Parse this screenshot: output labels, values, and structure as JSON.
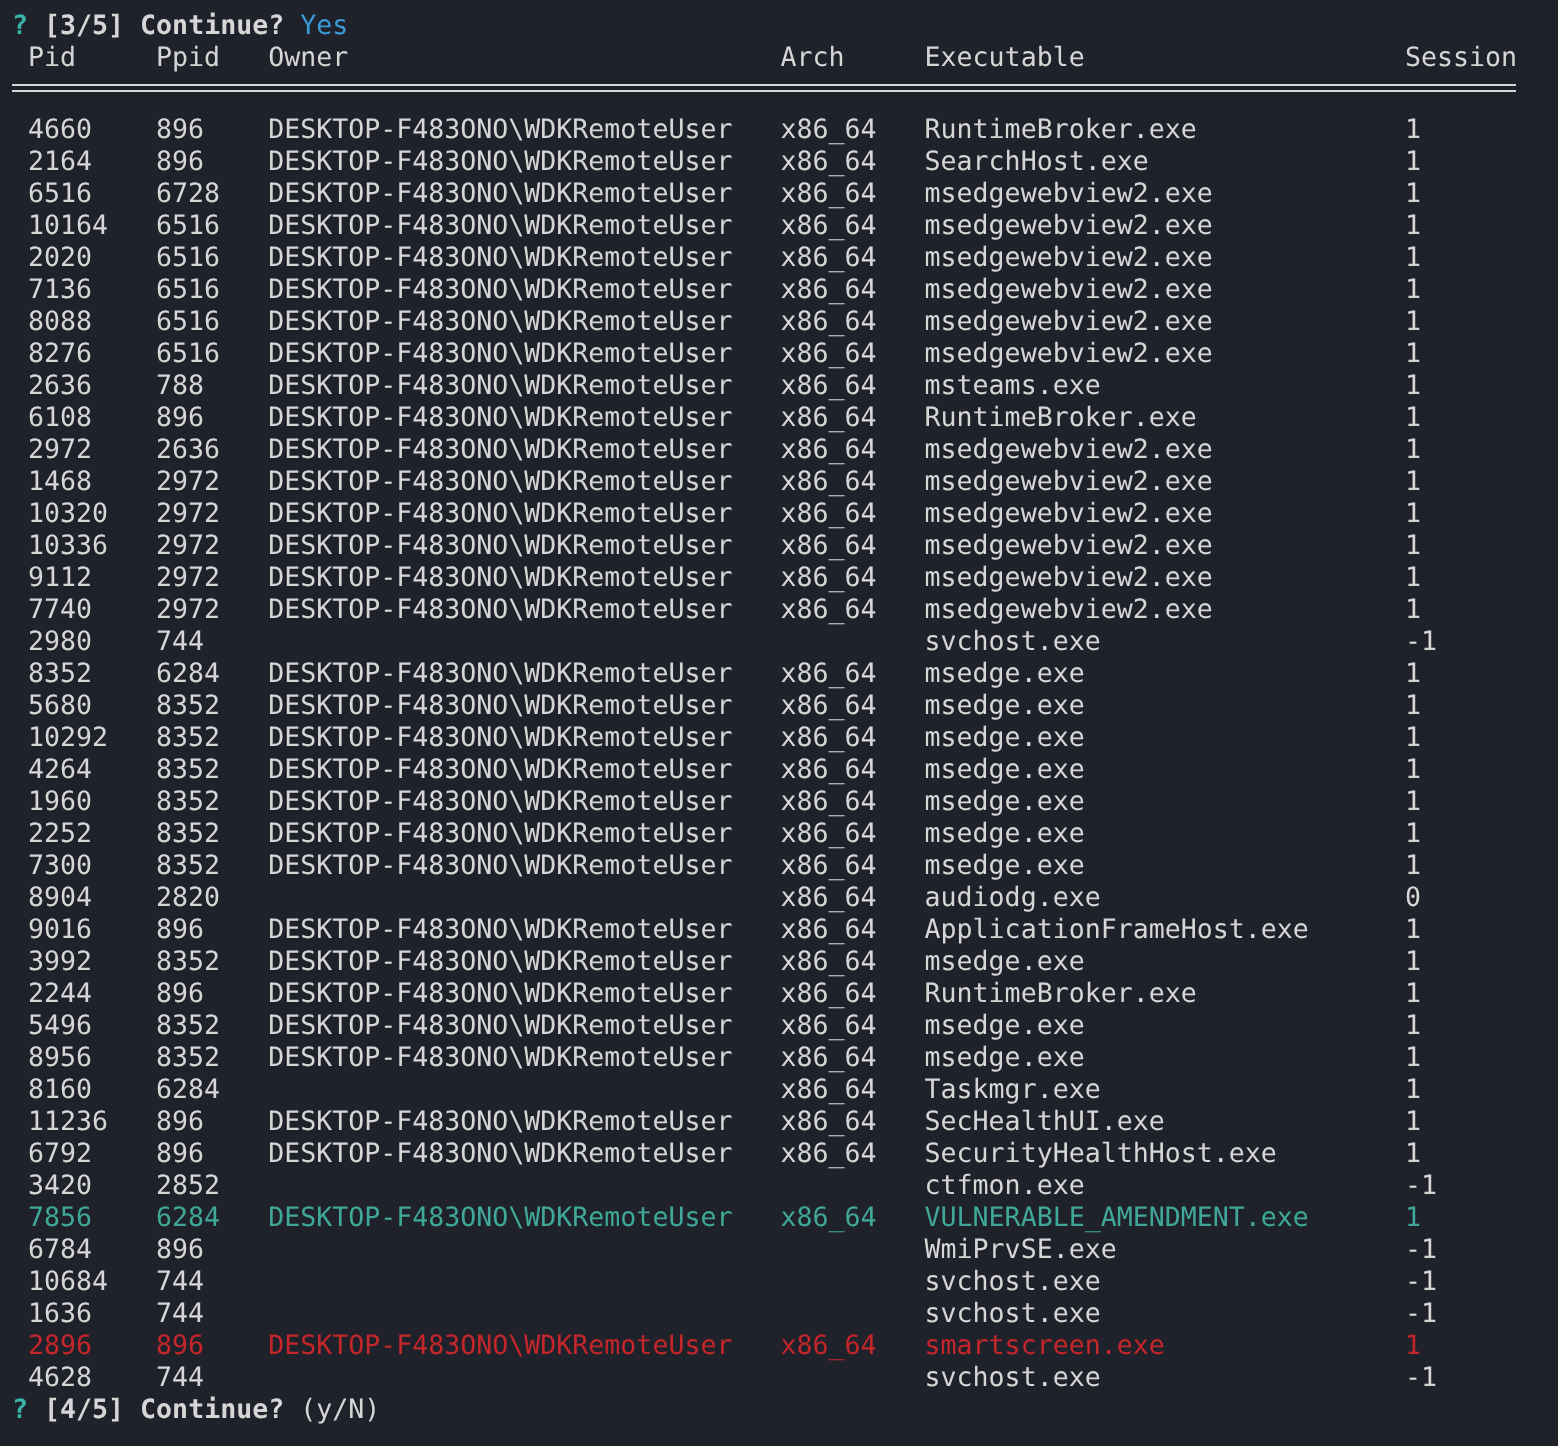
{
  "prompt_top": {
    "mark": "?",
    "step": "[3/5]",
    "question": "Continue?",
    "answer": "Yes"
  },
  "columns": [
    "Pid",
    "Ppid",
    "Owner",
    "Arch",
    "Executable",
    "Session"
  ],
  "rows": [
    {
      "kind": "normal",
      "cells": [
        "4660",
        "896",
        "DESKTOP-F483ONO\\WDKRemoteUser",
        "x86_64",
        "RuntimeBroker.exe",
        "1"
      ]
    },
    {
      "kind": "normal",
      "cells": [
        "2164",
        "896",
        "DESKTOP-F483ONO\\WDKRemoteUser",
        "x86_64",
        "SearchHost.exe",
        "1"
      ]
    },
    {
      "kind": "normal",
      "cells": [
        "6516",
        "6728",
        "DESKTOP-F483ONO\\WDKRemoteUser",
        "x86_64",
        "msedgewebview2.exe",
        "1"
      ]
    },
    {
      "kind": "normal",
      "cells": [
        "10164",
        "6516",
        "DESKTOP-F483ONO\\WDKRemoteUser",
        "x86_64",
        "msedgewebview2.exe",
        "1"
      ]
    },
    {
      "kind": "normal",
      "cells": [
        "2020",
        "6516",
        "DESKTOP-F483ONO\\WDKRemoteUser",
        "x86_64",
        "msedgewebview2.exe",
        "1"
      ]
    },
    {
      "kind": "normal",
      "cells": [
        "7136",
        "6516",
        "DESKTOP-F483ONO\\WDKRemoteUser",
        "x86_64",
        "msedgewebview2.exe",
        "1"
      ]
    },
    {
      "kind": "normal",
      "cells": [
        "8088",
        "6516",
        "DESKTOP-F483ONO\\WDKRemoteUser",
        "x86_64",
        "msedgewebview2.exe",
        "1"
      ]
    },
    {
      "kind": "normal",
      "cells": [
        "8276",
        "6516",
        "DESKTOP-F483ONO\\WDKRemoteUser",
        "x86_64",
        "msedgewebview2.exe",
        "1"
      ]
    },
    {
      "kind": "normal",
      "cells": [
        "2636",
        "788",
        "DESKTOP-F483ONO\\WDKRemoteUser",
        "x86_64",
        "msteams.exe",
        "1"
      ]
    },
    {
      "kind": "normal",
      "cells": [
        "6108",
        "896",
        "DESKTOP-F483ONO\\WDKRemoteUser",
        "x86_64",
        "RuntimeBroker.exe",
        "1"
      ]
    },
    {
      "kind": "normal",
      "cells": [
        "2972",
        "2636",
        "DESKTOP-F483ONO\\WDKRemoteUser",
        "x86_64",
        "msedgewebview2.exe",
        "1"
      ]
    },
    {
      "kind": "normal",
      "cells": [
        "1468",
        "2972",
        "DESKTOP-F483ONO\\WDKRemoteUser",
        "x86_64",
        "msedgewebview2.exe",
        "1"
      ]
    },
    {
      "kind": "normal",
      "cells": [
        "10320",
        "2972",
        "DESKTOP-F483ONO\\WDKRemoteUser",
        "x86_64",
        "msedgewebview2.exe",
        "1"
      ]
    },
    {
      "kind": "normal",
      "cells": [
        "10336",
        "2972",
        "DESKTOP-F483ONO\\WDKRemoteUser",
        "x86_64",
        "msedgewebview2.exe",
        "1"
      ]
    },
    {
      "kind": "normal",
      "cells": [
        "9112",
        "2972",
        "DESKTOP-F483ONO\\WDKRemoteUser",
        "x86_64",
        "msedgewebview2.exe",
        "1"
      ]
    },
    {
      "kind": "normal",
      "cells": [
        "7740",
        "2972",
        "DESKTOP-F483ONO\\WDKRemoteUser",
        "x86_64",
        "msedgewebview2.exe",
        "1"
      ]
    },
    {
      "kind": "normal",
      "cells": [
        "2980",
        "744",
        "",
        "",
        "svchost.exe",
        "-1"
      ]
    },
    {
      "kind": "normal",
      "cells": [
        "8352",
        "6284",
        "DESKTOP-F483ONO\\WDKRemoteUser",
        "x86_64",
        "msedge.exe",
        "1"
      ]
    },
    {
      "kind": "normal",
      "cells": [
        "5680",
        "8352",
        "DESKTOP-F483ONO\\WDKRemoteUser",
        "x86_64",
        "msedge.exe",
        "1"
      ]
    },
    {
      "kind": "normal",
      "cells": [
        "10292",
        "8352",
        "DESKTOP-F483ONO\\WDKRemoteUser",
        "x86_64",
        "msedge.exe",
        "1"
      ]
    },
    {
      "kind": "normal",
      "cells": [
        "4264",
        "8352",
        "DESKTOP-F483ONO\\WDKRemoteUser",
        "x86_64",
        "msedge.exe",
        "1"
      ]
    },
    {
      "kind": "normal",
      "cells": [
        "1960",
        "8352",
        "DESKTOP-F483ONO\\WDKRemoteUser",
        "x86_64",
        "msedge.exe",
        "1"
      ]
    },
    {
      "kind": "normal",
      "cells": [
        "2252",
        "8352",
        "DESKTOP-F483ONO\\WDKRemoteUser",
        "x86_64",
        "msedge.exe",
        "1"
      ]
    },
    {
      "kind": "normal",
      "cells": [
        "7300",
        "8352",
        "DESKTOP-F483ONO\\WDKRemoteUser",
        "x86_64",
        "msedge.exe",
        "1"
      ]
    },
    {
      "kind": "normal",
      "cells": [
        "8904",
        "2820",
        "",
        "x86_64",
        "audiodg.exe",
        "0"
      ]
    },
    {
      "kind": "normal",
      "cells": [
        "9016",
        "896",
        "DESKTOP-F483ONO\\WDKRemoteUser",
        "x86_64",
        "ApplicationFrameHost.exe",
        "1"
      ]
    },
    {
      "kind": "normal",
      "cells": [
        "3992",
        "8352",
        "DESKTOP-F483ONO\\WDKRemoteUser",
        "x86_64",
        "msedge.exe",
        "1"
      ]
    },
    {
      "kind": "normal",
      "cells": [
        "2244",
        "896",
        "DESKTOP-F483ONO\\WDKRemoteUser",
        "x86_64",
        "RuntimeBroker.exe",
        "1"
      ]
    },
    {
      "kind": "normal",
      "cells": [
        "5496",
        "8352",
        "DESKTOP-F483ONO\\WDKRemoteUser",
        "x86_64",
        "msedge.exe",
        "1"
      ]
    },
    {
      "kind": "normal",
      "cells": [
        "8956",
        "8352",
        "DESKTOP-F483ONO\\WDKRemoteUser",
        "x86_64",
        "msedge.exe",
        "1"
      ]
    },
    {
      "kind": "normal",
      "cells": [
        "8160",
        "6284",
        "",
        "x86_64",
        "Taskmgr.exe",
        "1"
      ]
    },
    {
      "kind": "normal",
      "cells": [
        "11236",
        "896",
        "DESKTOP-F483ONO\\WDKRemoteUser",
        "x86_64",
        "SecHealthUI.exe",
        "1"
      ]
    },
    {
      "kind": "normal",
      "cells": [
        "6792",
        "896",
        "DESKTOP-F483ONO\\WDKRemoteUser",
        "x86_64",
        "SecurityHealthHost.exe",
        "1"
      ]
    },
    {
      "kind": "normal",
      "cells": [
        "3420",
        "2852",
        "",
        "",
        "ctfmon.exe",
        "-1"
      ]
    },
    {
      "kind": "highlight",
      "cells": [
        "7856",
        "6284",
        "DESKTOP-F483ONO\\WDKRemoteUser",
        "x86_64",
        "VULNERABLE_AMENDMENT.exe",
        "1"
      ]
    },
    {
      "kind": "normal",
      "cells": [
        "6784",
        "896",
        "",
        "",
        "WmiPrvSE.exe",
        "-1"
      ]
    },
    {
      "kind": "normal",
      "cells": [
        "10684",
        "744",
        "",
        "",
        "svchost.exe",
        "-1"
      ]
    },
    {
      "kind": "normal",
      "cells": [
        "1636",
        "744",
        "",
        "",
        "svchost.exe",
        "-1"
      ]
    },
    {
      "kind": "alert",
      "cells": [
        "2896",
        "896",
        "DESKTOP-F483ONO\\WDKRemoteUser",
        "x86_64",
        "smartscreen.exe",
        "1"
      ]
    },
    {
      "kind": "normal",
      "cells": [
        "4628",
        "744",
        "",
        "",
        "svchost.exe",
        "-1"
      ]
    }
  ],
  "prompt_bottom": {
    "mark": "?",
    "step": "[4/5]",
    "question": "Continue?",
    "hint": "(y/N)"
  }
}
